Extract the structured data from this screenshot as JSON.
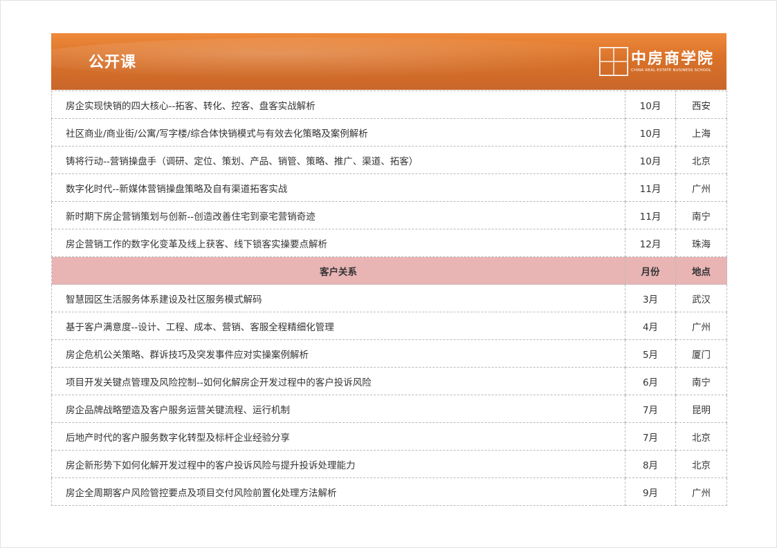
{
  "header": {
    "title": "公开课",
    "logo_name": "中房商学院",
    "logo_sub": "CHINA REAL ESTATE BUSINESS SCHOOL"
  },
  "marketing_rows": [
    {
      "title": "房企实现快销的四大核心--拓客、转化、控客、盘客实战解析",
      "month": "10月",
      "city": "西安"
    },
    {
      "title": "社区商业/商业街/公寓/写字楼/综合体快销模式与有效去化策略及案例解析",
      "month": "10月",
      "city": "上海"
    },
    {
      "title": "铸将行动--营销操盘手（调研、定位、策划、产品、销管、策略、推广、渠道、拓客）",
      "month": "10月",
      "city": "北京"
    },
    {
      "title": "数字化时代--新媒体营销操盘策略及自有渠道拓客实战",
      "month": "11月",
      "city": "广州"
    },
    {
      "title": "新时期下房企营销策划与创新--创造改善住宅到豪宅营销奇迹",
      "month": "11月",
      "city": "南宁"
    },
    {
      "title": "房企营销工作的数字化变革及线上获客、线下锁客实操要点解析",
      "month": "12月",
      "city": "珠海"
    }
  ],
  "section": {
    "title": "客户关系",
    "month_header": "月份",
    "city_header": "地点"
  },
  "customer_rows": [
    {
      "title": "智慧园区生活服务体系建设及社区服务模式解码",
      "month": "3月",
      "city": "武汉"
    },
    {
      "title": "基于客户满意度--设计、工程、成本、营销、客服全程精细化管理",
      "month": "4月",
      "city": "广州"
    },
    {
      "title": "房企危机公关策略、群诉技巧及突发事件应对实操案例解析",
      "month": "5月",
      "city": "厦门"
    },
    {
      "title": "项目开发关键点管理及风险控制--如何化解房企开发过程中的客户投诉风险",
      "month": "6月",
      "city": "南宁"
    },
    {
      "title": "房企品牌战略塑造及客户服务运营关键流程、运行机制",
      "month": "7月",
      "city": "昆明"
    },
    {
      "title": "后地产时代的客户服务数字化转型及标杆企业经验分享",
      "month": "7月",
      "city": "北京"
    },
    {
      "title": "房企新形势下如何化解开发过程中的客户投诉风险与提升投诉处理能力",
      "month": "8月",
      "city": "北京"
    },
    {
      "title": "房企全周期客户风险管控要点及项目交付风险前置化处理方法解析",
      "month": "9月",
      "city": "广州"
    }
  ]
}
